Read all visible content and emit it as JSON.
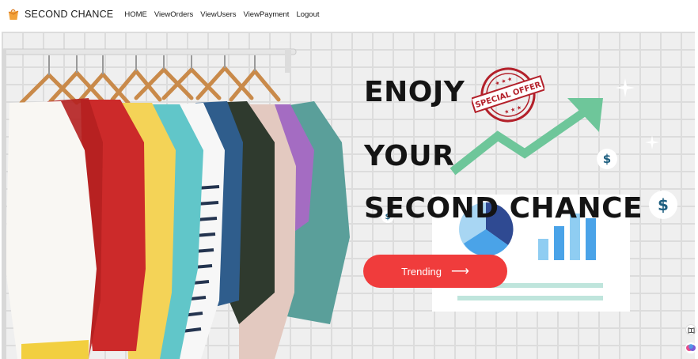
{
  "brand": {
    "name": "SECOND CHANCE",
    "logo_icon": "shopping-bag-icon",
    "logo_color": "#f2a23a"
  },
  "nav": {
    "items": [
      {
        "label": "HOME"
      },
      {
        "label": "ViewOrders"
      },
      {
        "label": "ViewUsers"
      },
      {
        "label": "ViewPayment"
      },
      {
        "label": "Logout"
      }
    ]
  },
  "hero": {
    "line1": "ENOJY",
    "line2": "YOUR",
    "line3": "SECOND CHANCE",
    "stamp_text": "SPECIAL OFFER",
    "cta_label": "Trending",
    "cta_icon": "arrow-right-icon",
    "cta_color": "#f03c3c",
    "accent_green": "#6ec69a",
    "chart_blue": "#4aa3e8",
    "dollar_symbol": "$"
  },
  "side_icons": [
    "book-icon",
    "brain-icon"
  ]
}
